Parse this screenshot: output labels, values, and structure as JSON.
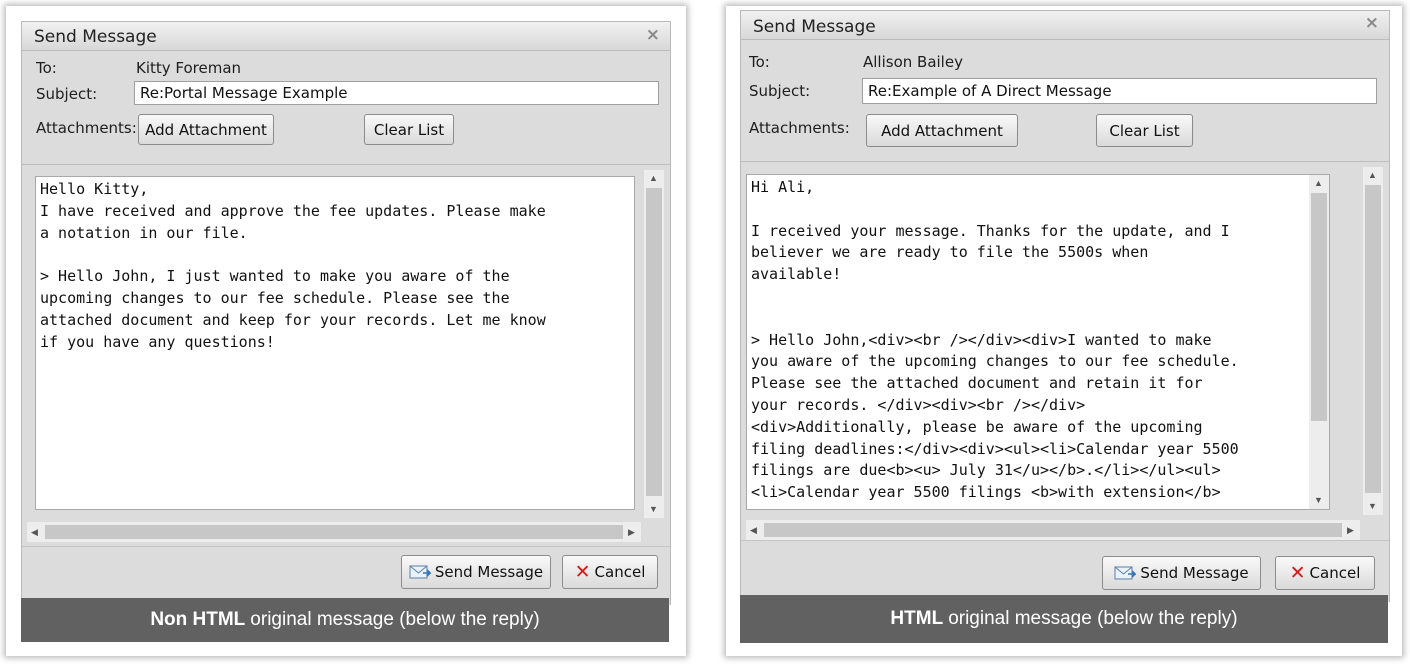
{
  "left": {
    "title": "Send Message",
    "close_glyph": "×",
    "to_label": "To:",
    "to_value": "Kitty Foreman",
    "subject_label": "Subject:",
    "subject_value": "Re:Portal Message Example",
    "attachments_label": "Attachments:",
    "add_attachment": "Add Attachment",
    "clear_list": "Clear List",
    "body": "Hello Kitty,\nI have received and approve the fee updates. Please make\na notation in our file.\n\n> Hello John, I just wanted to make you aware of the\nupcoming changes to our fee schedule. Please see the\nattached document and keep for your records. Let me know\nif you have any questions!",
    "send": "Send Message",
    "cancel": "Cancel",
    "caption_bold": "Non HTML",
    "caption_rest": "original message (below the reply)"
  },
  "right": {
    "title": "Send Message",
    "close_glyph": "×",
    "to_label": "To:",
    "to_value": "Allison Bailey",
    "subject_label": "Subject:",
    "subject_value": "Re:Example of A Direct Message",
    "attachments_label": "Attachments:",
    "add_attachment": "Add Attachment",
    "clear_list": "Clear List",
    "body": "Hi Ali,\n\nI received your message. Thanks for the update, and I\nbeliever we are ready to file the 5500s when\navailable!\n\n\n> Hello John,<div><br /></div><div>I wanted to make\nyou aware of the upcoming changes to our fee schedule.\nPlease see the attached document and retain it for\nyour records. </div><div><br /></div>\n<div>Additionally, please be aware of the upcoming\nfiling deadlines:</div><div><ul><li>Calendar year 5500\nfilings are due<b><u> July 31</u></b>.</li></ul><ul>\n<li>Calendar year 5500 filings <b>with extension</b>",
    "send": "Send Message",
    "cancel": "Cancel",
    "caption_bold": "HTML",
    "caption_rest": "original message (below the reply)"
  },
  "icons": {
    "send": "envelope-icon",
    "cancel": "red-x-icon",
    "close": "close-icon"
  },
  "colors": {
    "caption_bg": "#616161",
    "cancel_x": "#d41a1a",
    "dialog_bg": "#dcdcdc"
  }
}
